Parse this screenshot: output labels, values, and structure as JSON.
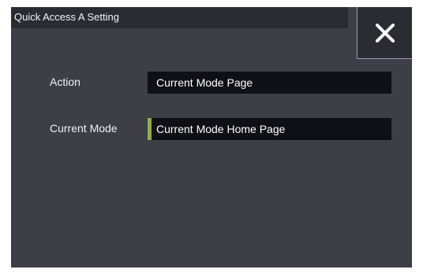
{
  "dialog": {
    "title": "Quick Access A Setting",
    "close_icon": "close-x-icon"
  },
  "fields": [
    {
      "label": "Action",
      "value": "Current Mode Page"
    },
    {
      "label": "Current Mode",
      "value": "Current Mode Home Page",
      "selected": true
    }
  ],
  "colors": {
    "panel_background": "#3d3e46",
    "title_bar": "#2b2c33",
    "field_background": "#0f1015",
    "selection_indicator": "#8fae4f",
    "text": "#f2f2f2"
  }
}
